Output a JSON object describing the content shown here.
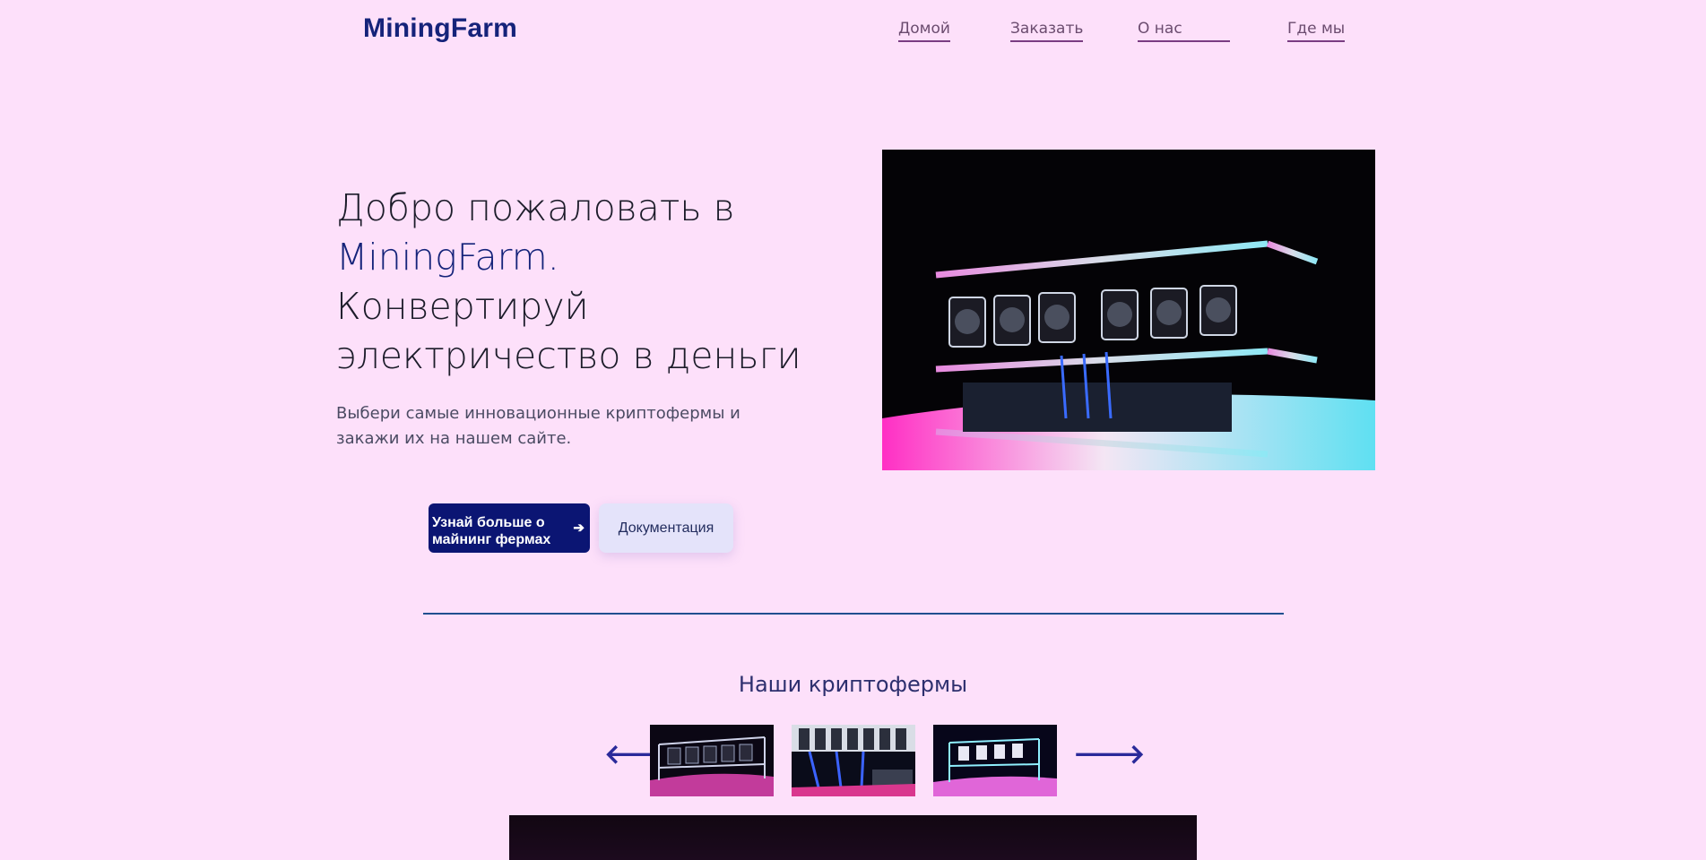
{
  "header": {
    "logo": "MiningFarm",
    "nav": [
      "Домой",
      "Заказать",
      "О нас",
      "Где мы"
    ]
  },
  "hero": {
    "title_line1": "Добро пожаловать в",
    "title_brand": "MiningFarm.",
    "title_line3": "Конвертируй",
    "title_line4": "электричество в деньги",
    "subtitle": "Выбери самые инновационные криптофермы и закажи их на нашем сайте.",
    "primary_button": "Узнай больше о майнинг фермах",
    "primary_button_icon": "arrow-right-icon",
    "secondary_button": "Документация",
    "image": "mining-rig-photo"
  },
  "farms": {
    "title": "Наши криптофермы",
    "prev_icon": "arrow-left-icon",
    "next_icon": "arrow-right-icon",
    "thumbnails": [
      "mining-rig-thumbnail-1",
      "mining-rig-thumbnail-2",
      "mining-rig-thumbnail-3"
    ]
  },
  "colors": {
    "background": "#fde0fa",
    "brand": "#15237a",
    "primary_button": "#0b1573",
    "secondary_button": "#e4e3fa",
    "nav_underline": "#7a3d82",
    "divider": "#1f4f8f"
  }
}
